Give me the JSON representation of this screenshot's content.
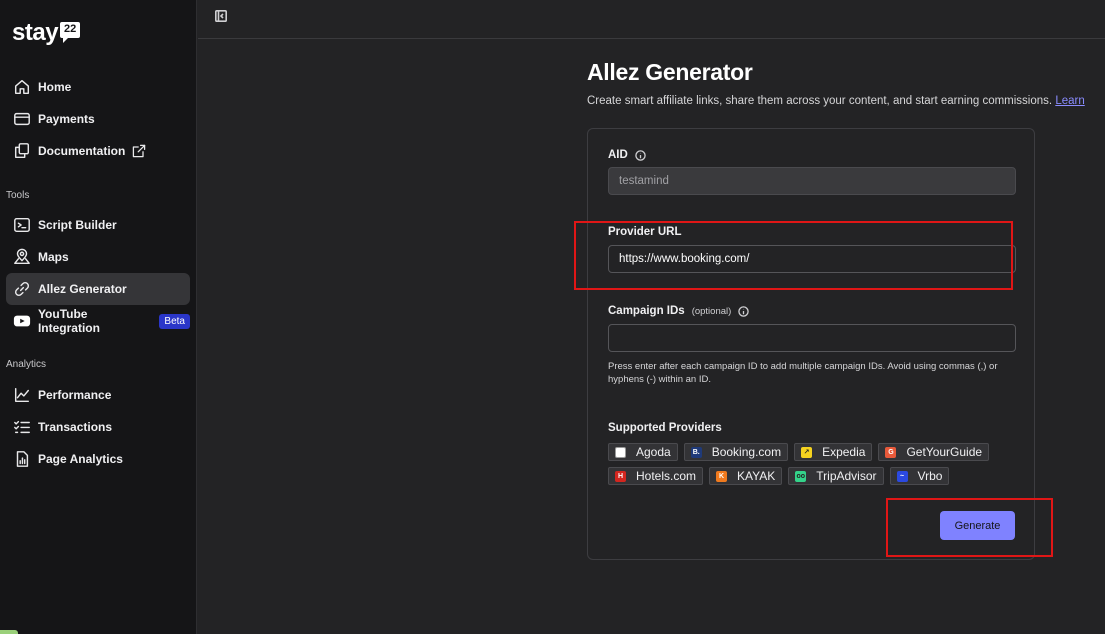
{
  "brand": {
    "name": "stay",
    "badge": "22"
  },
  "sidebar": {
    "main": [
      {
        "label": "Home",
        "icon": "home-icon"
      },
      {
        "label": "Payments",
        "icon": "card-icon"
      },
      {
        "label": "Documentation",
        "icon": "docs-icon"
      }
    ],
    "tools_label": "Tools",
    "tools": [
      {
        "label": "Script Builder",
        "icon": "terminal-icon"
      },
      {
        "label": "Maps",
        "icon": "map-pin-icon"
      },
      {
        "label": "Allez Generator",
        "icon": "link-icon",
        "active": true
      },
      {
        "label": "YouTube Integration",
        "icon": "youtube-icon",
        "badge": "Beta"
      }
    ],
    "analytics_label": "Analytics",
    "analytics": [
      {
        "label": "Performance",
        "icon": "chart-line-icon"
      },
      {
        "label": "Transactions",
        "icon": "checklist-icon"
      },
      {
        "label": "Page Analytics",
        "icon": "report-icon"
      }
    ]
  },
  "page": {
    "title": "Allez Generator",
    "subtitle": "Create smart affiliate links, share them across your content, and start earning commissions.",
    "learn_link": "Learn"
  },
  "form": {
    "aid_label": "AID",
    "aid_value": "testamind",
    "provider_label": "Provider URL",
    "provider_value": "https://www.booking.com/",
    "campaign_label": "Campaign IDs",
    "campaign_optional": "(optional)",
    "campaign_value": "",
    "campaign_help": "Press enter after each campaign ID to add multiple campaign IDs. Avoid using commas (,) or hyphens (-) within an ID.",
    "providers_label": "Supported Providers",
    "providers_row1": [
      {
        "name": "Agoda",
        "color": "#ffffff",
        "glyph": ""
      },
      {
        "name": "Booking.com",
        "color": "#1f3a7a",
        "glyph": "B."
      },
      {
        "name": "Expedia",
        "color": "#f5d21f",
        "glyph": "↗"
      },
      {
        "name": "GetYourGuide",
        "color": "#e8593a",
        "glyph": "G"
      }
    ],
    "providers_row2": [
      {
        "name": "Hotels.com",
        "color": "#d3261f",
        "glyph": "H"
      },
      {
        "name": "KAYAK",
        "color": "#f07a1e",
        "glyph": "K"
      },
      {
        "name": "TripAdvisor",
        "color": "#34d38a",
        "glyph": "oo"
      },
      {
        "name": "Vrbo",
        "color": "#2b49e0",
        "glyph": "~"
      }
    ],
    "generate_label": "Generate"
  }
}
